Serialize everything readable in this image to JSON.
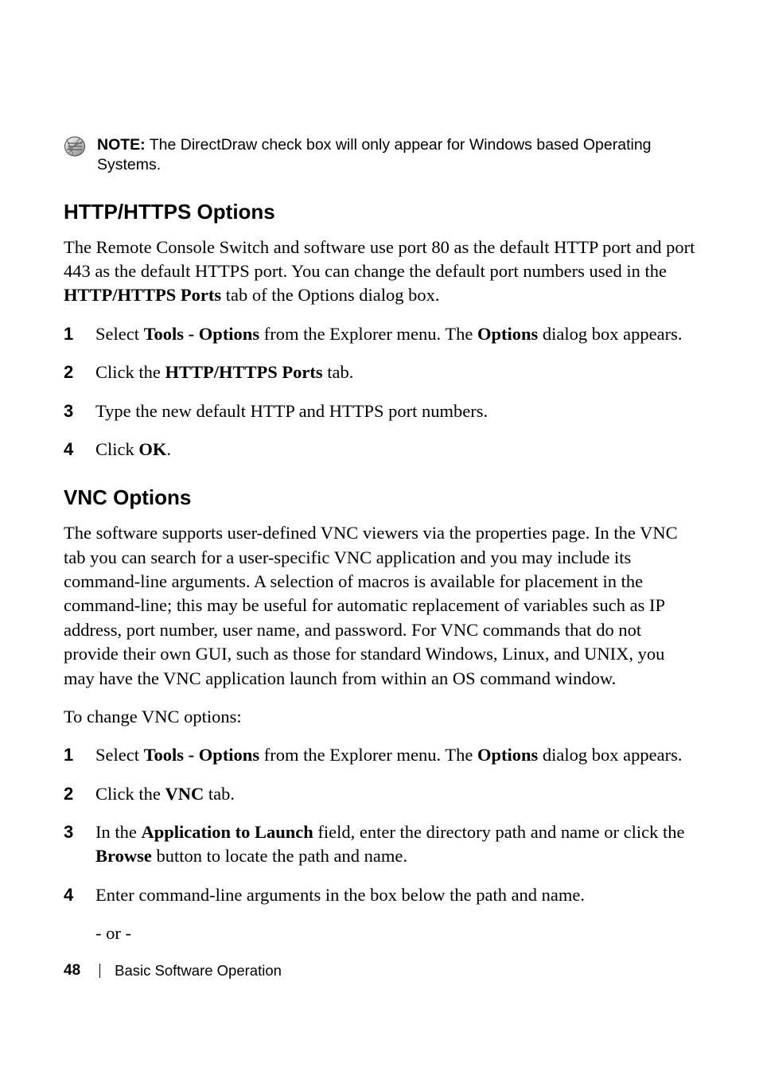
{
  "note": {
    "label": "NOTE:",
    "text": "The DirectDraw check box will only appear for Windows based Operating Systems."
  },
  "section1": {
    "heading": "HTTP/HTTPS Options",
    "intro": "The Remote Console Switch and software use port 80 as the default HTTP port and port 443 as the default HTTPS port. You can change the default port numbers used in the HTTP/HTTPS Ports tab of the Options dialog box.",
    "intro_parts": {
      "p1": "The Remote Console Switch and software use port 80 as the default HTTP port and port 443 as the default HTTPS port. You can change the default port numbers used in the ",
      "b1": "HTTP/HTTPS Ports",
      "p2": " tab of the Options dialog box."
    },
    "step1": {
      "p1": "Select ",
      "b1": "Tools - Options",
      "p2": " from the Explorer menu. The ",
      "b2": "Options",
      "p3": " dialog box appears."
    },
    "step2": {
      "p1": "Click the ",
      "b1": "HTTP/HTTPS Ports",
      "p2": " tab."
    },
    "step3": {
      "p1": "Type the new default HTTP and HTTPS port numbers."
    },
    "step4": {
      "p1": "Click ",
      "b1": "OK",
      "p2": "."
    }
  },
  "section2": {
    "heading": "VNC Options",
    "intro": "The software supports user-defined VNC viewers via the properties page. In the VNC tab you can search for a user-specific VNC application and you may include its command-line arguments. A selection of macros is available for placement in the command-line; this may be useful for automatic replacement of variables such as IP address, port number, user name, and password. For VNC commands that do not provide their own GUI, such as those for standard Windows, Linux, and UNIX, you may have the VNC application launch from within an OS command window.",
    "lead": "To change VNC options:",
    "step1": {
      "p1": "Select ",
      "b1": "Tools - Options",
      "p2": " from the Explorer menu. The ",
      "b2": "Options",
      "p3": " dialog box appears."
    },
    "step2": {
      "p1": "Click the ",
      "b1": "VNC",
      "p2": " tab."
    },
    "step3": {
      "p1": "In the ",
      "b1": "Application to Launch",
      "p2": " field, enter the directory path and name or click the ",
      "b2": "Browse",
      "p3": " button to locate the path and name."
    },
    "step4": {
      "p1": "Enter command-line arguments in the box below the path and name."
    },
    "or": "- or -"
  },
  "footer": {
    "page": "48",
    "chapter": "Basic Software Operation"
  }
}
